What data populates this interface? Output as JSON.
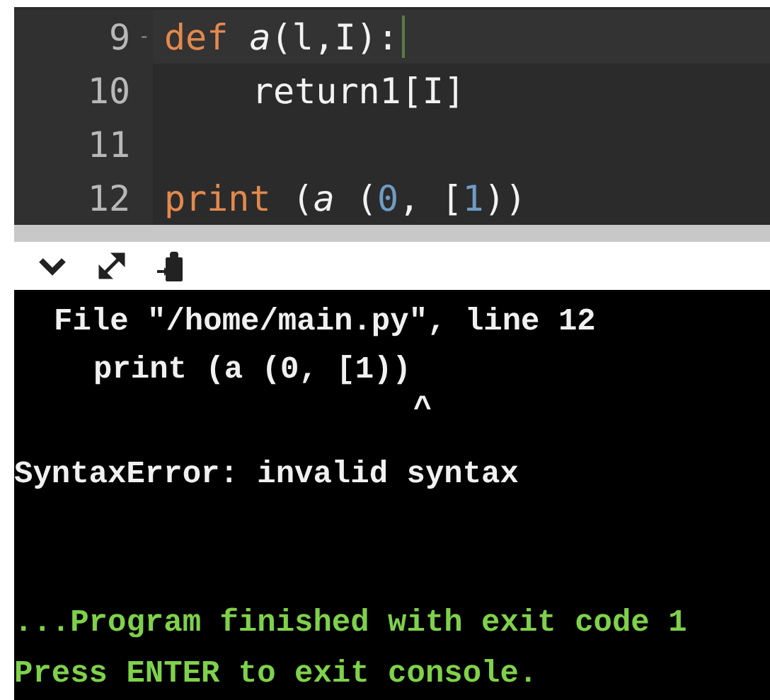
{
  "editor": {
    "lines": [
      {
        "number": "9",
        "fold_marker": "-",
        "active": true,
        "cursor": true,
        "indent": false,
        "tokens": [
          {
            "kind": "keyword",
            "text": "def "
          },
          {
            "kind": "function",
            "text": "a"
          },
          {
            "kind": "plain",
            "text": "(l,I):"
          }
        ]
      },
      {
        "number": "10",
        "active": false,
        "cursor": false,
        "indent": true,
        "tokens": [
          {
            "kind": "plain",
            "text": "return1[I]"
          }
        ]
      },
      {
        "number": "11",
        "active": false,
        "cursor": false,
        "indent": false
      },
      {
        "number": "12",
        "active": false,
        "cursor": false,
        "indent": false,
        "tokens": [
          {
            "kind": "keyword",
            "text": "print"
          },
          {
            "kind": "plain",
            "text": " ("
          },
          {
            "kind": "function",
            "text": "a"
          },
          {
            "kind": "plain",
            "text": " ("
          },
          {
            "kind": "number",
            "text": "0"
          },
          {
            "kind": "plain",
            "text": ", ["
          },
          {
            "kind": "number",
            "text": "1"
          },
          {
            "kind": "plain",
            "text": "))"
          }
        ]
      }
    ]
  },
  "console": {
    "lines": [
      {
        "kind": "location",
        "text": "File \"/home/main.py\", line 12"
      },
      {
        "kind": "source",
        "text": "print (a (0, [1))"
      },
      {
        "kind": "pointer",
        "text": "^"
      },
      {
        "kind": "error",
        "text": "SyntaxError: invalid syntax"
      },
      {
        "kind": "status",
        "text": "...Program finished with exit code 1"
      },
      {
        "kind": "status",
        "text": "Press ENTER to exit console."
      }
    ]
  }
}
